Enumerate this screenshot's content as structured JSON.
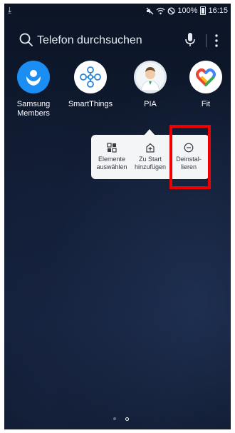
{
  "status_bar": {
    "download_icon": "download-arrow-icon",
    "mute_icon": "mute-icon",
    "wifi_icon": "wifi-icon",
    "dnd_icon": "do-not-disturb-icon",
    "battery_percent": "100%",
    "time": "16:15"
  },
  "search": {
    "placeholder": "Telefon durchsuchen"
  },
  "apps": [
    {
      "label_line1": "Samsung",
      "label_line2": "Members",
      "icon": "samsung-members-icon",
      "color": "#1a8ef2"
    },
    {
      "label_line1": "SmartThings",
      "label_line2": "",
      "icon": "smartthings-icon",
      "color": "#ffffff"
    },
    {
      "label_line1": "PIA",
      "label_line2": "",
      "icon": "pia-icon",
      "color": "#e3e8ee"
    },
    {
      "label_line1": "Fit",
      "label_line2": "",
      "icon": "google-fit-icon",
      "color": "#ffffff"
    }
  ],
  "popup": {
    "items": [
      {
        "label": "Elemente\nauswählen",
        "icon": "select-items-icon"
      },
      {
        "label": "Zu Start\nhinzufügen",
        "icon": "add-to-home-icon"
      },
      {
        "label": "Deinstal-\nlieren",
        "icon": "uninstall-icon"
      }
    ]
  },
  "highlight_color": "#ee0000",
  "page_indicator": {
    "count": 2,
    "active_index": 1
  }
}
